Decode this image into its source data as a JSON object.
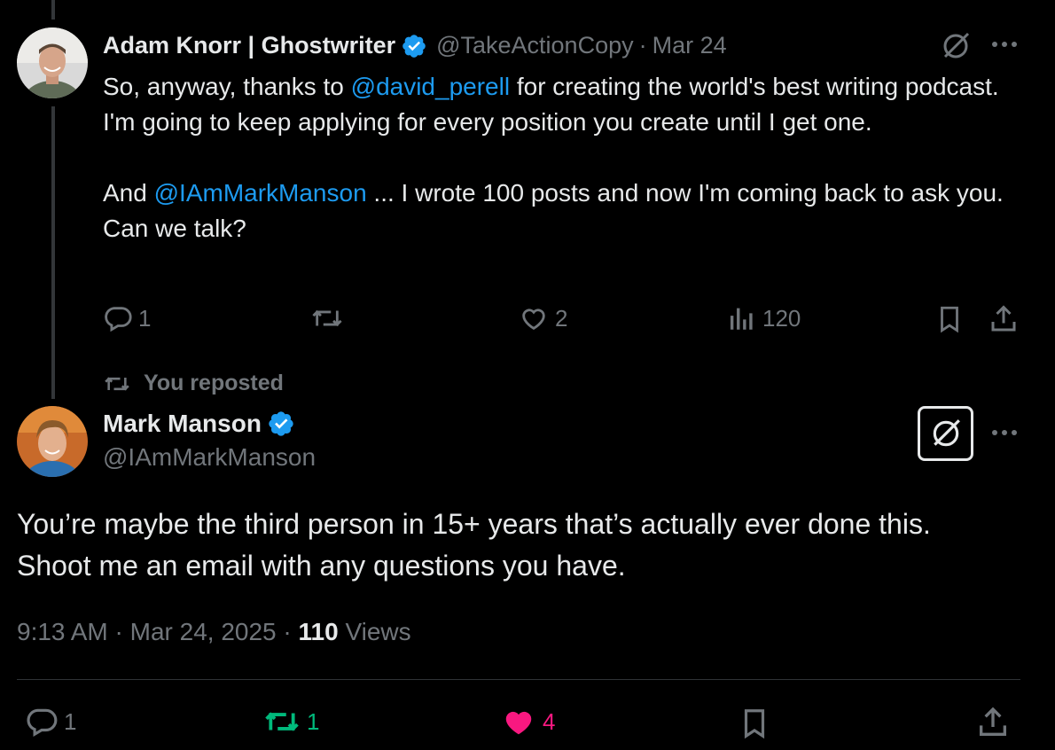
{
  "parent_tweet": {
    "author_name": "Adam Knorr | Ghostwriter",
    "handle": "@TakeActionCopy",
    "separator": "·",
    "date": "Mar 24",
    "text_segments": [
      {
        "t": "So, anyway, thanks to ",
        "link": false
      },
      {
        "t": "@david_perell",
        "link": true
      },
      {
        "t": " for creating the world's best writing podcast. I'm going to keep applying for every position you create until I get one.",
        "link": false
      }
    ],
    "text_segments_2": [
      {
        "t": "And ",
        "link": false
      },
      {
        "t": "@IAmMarkManson",
        "link": true
      },
      {
        "t": " ... I wrote 100 posts and now I'm coming back to ask you. Can we talk?",
        "link": false
      }
    ],
    "reply_count": "1",
    "retweet_count": "",
    "like_count": "2",
    "view_count": "120"
  },
  "repost_banner": {
    "label": "You reposted"
  },
  "main_tweet": {
    "author_name": "Mark Manson",
    "handle": "@IAmMarkManson",
    "text_line_1": "You’re maybe the third person in 15+ years that’s actually ever done this.",
    "text_line_2": "Shoot me an email with any questions you have.",
    "time": "9:13 AM",
    "sep1": "·",
    "date": "Mar 24, 2025",
    "sep2": "·",
    "views_count": "110",
    "views_label": "Views",
    "reply_count": "1",
    "retweet_count": "1",
    "like_count": "4"
  },
  "colors": {
    "background": "#000000",
    "text": "#e7e9ea",
    "muted": "#71767b",
    "link": "#1d9bf0",
    "verified": "#1d9bf0",
    "retweet_active": "#00ba7c",
    "like_active": "#f91880",
    "divider": "#2f3336"
  },
  "icons": {
    "more": "more-icon",
    "grok": "grok-icon",
    "reply": "reply-icon",
    "retweet": "retweet-icon",
    "like": "heart-icon",
    "views": "views-icon",
    "bookmark": "bookmark-icon",
    "share": "share-icon"
  }
}
